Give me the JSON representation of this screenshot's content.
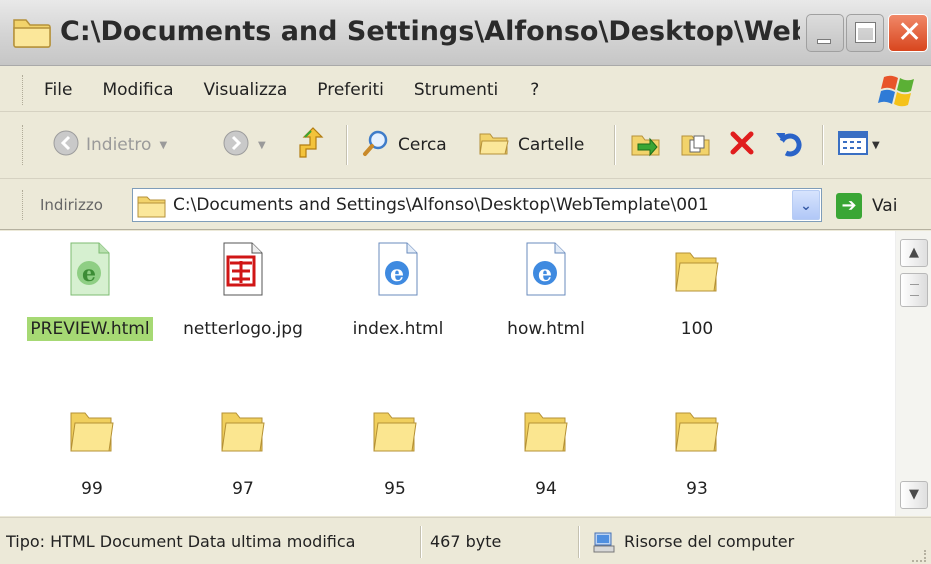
{
  "window": {
    "title": "C:\\Documents and Settings\\Alfonso\\Desktop\\WebTemplat..."
  },
  "menu": {
    "items": [
      "File",
      "Modifica",
      "Visualizza",
      "Preferiti",
      "Strumenti",
      "?"
    ]
  },
  "toolbar": {
    "back_label": "Indietro",
    "search_label": "Cerca",
    "folders_label": "Cartelle"
  },
  "address": {
    "label": "Indirizzo",
    "value": "C:\\Documents and Settings\\Alfonso\\Desktop\\WebTemplate\\001",
    "go_label": "Vai"
  },
  "files": [
    {
      "name": "PREVIEW.html",
      "icon": "ie-html-icon",
      "selected": true
    },
    {
      "name": "netterlogo.jpg",
      "icon": "image-file-icon",
      "selected": false
    },
    {
      "name": "index.html",
      "icon": "ie-html-icon",
      "selected": false
    },
    {
      "name": "how.html",
      "icon": "ie-html-icon",
      "selected": false
    },
    {
      "name": "100",
      "icon": "folder-icon",
      "selected": false
    },
    {
      "name": "99",
      "icon": "folder-icon",
      "selected": false
    },
    {
      "name": "97",
      "icon": "folder-icon",
      "selected": false
    },
    {
      "name": "95",
      "icon": "folder-icon",
      "selected": false
    },
    {
      "name": "94",
      "icon": "folder-icon",
      "selected": false
    },
    {
      "name": "93",
      "icon": "folder-icon",
      "selected": false
    }
  ],
  "status": {
    "type_info": "Tipo: HTML Document Data ultima modifica",
    "size": "467 byte",
    "location": "Risorse del computer"
  },
  "colors": {
    "selection": "#a6d974",
    "close_button": "#d8461e",
    "title_bar": "#d5d5d5"
  }
}
